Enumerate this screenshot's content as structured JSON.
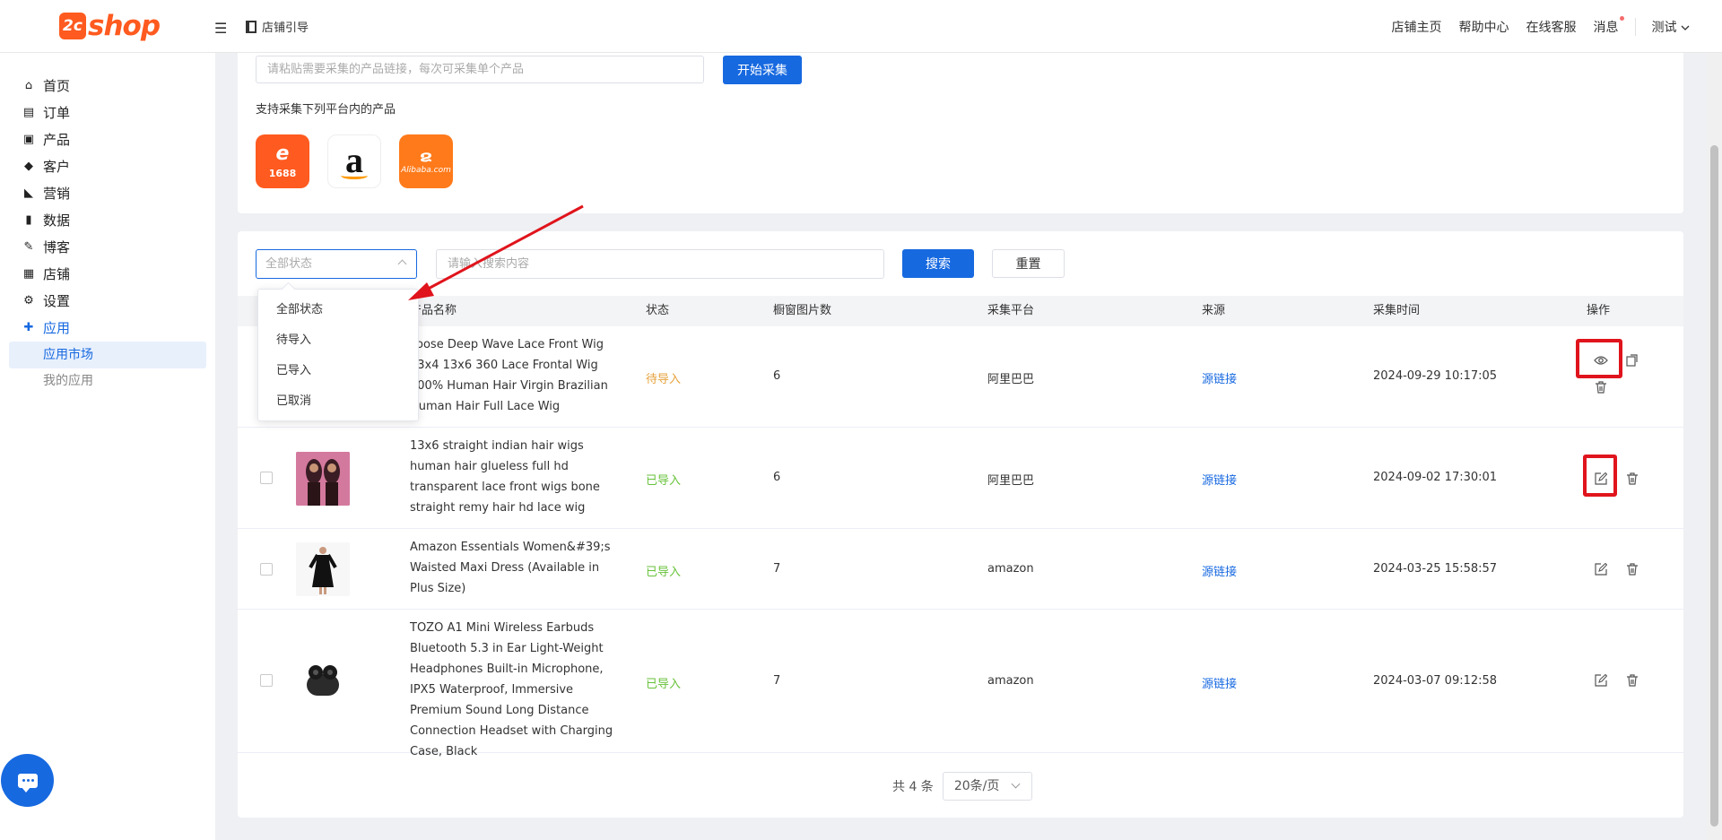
{
  "header": {
    "logo_mark": "2c",
    "logo_text": "shop",
    "store_guide": "店铺引导",
    "links": [
      "店铺主页",
      "帮助中心",
      "在线客服",
      "消息"
    ],
    "user": "测试"
  },
  "sidebar": {
    "items": [
      {
        "label": "首页",
        "icon": "home-icon"
      },
      {
        "label": "订单",
        "icon": "clipboard-icon"
      },
      {
        "label": "产品",
        "icon": "bag-icon"
      },
      {
        "label": "客户",
        "icon": "diamond-icon"
      },
      {
        "label": "营销",
        "icon": "tag-icon"
      },
      {
        "label": "数据",
        "icon": "bar-chart-icon"
      },
      {
        "label": "博客",
        "icon": "edit-icon"
      },
      {
        "label": "店铺",
        "icon": "store-icon"
      },
      {
        "label": "设置",
        "icon": "gear-icon"
      },
      {
        "label": "应用",
        "icon": "puzzle-icon"
      }
    ],
    "sub_items": [
      "应用市场",
      "我的应用"
    ]
  },
  "collect": {
    "url_placeholder": "请粘贴需要采集的产品链接，每次可采集单个产品",
    "start_button": "开始采集",
    "support_text": "支持采集下列平台内的产品",
    "platforms": [
      "1688",
      "a",
      "Alibaba.com"
    ]
  },
  "filter": {
    "status_placeholder": "全部状态",
    "search_placeholder": "请输入搜索内容",
    "search_button": "搜索",
    "reset_button": "重置",
    "dropdown_options": [
      "全部状态",
      "待导入",
      "已导入",
      "已取消"
    ]
  },
  "table": {
    "headers": [
      "产品名称",
      "状态",
      "橱窗图片数",
      "采集平台",
      "来源",
      "采集时间",
      "操作"
    ],
    "rows": [
      {
        "name": "Loose Deep Wave Lace Front Wig 13x4 13x6 360 Lace Frontal Wig 100% Human Hair Virgin Brazilian Human Hair Full Lace Wig",
        "status": "待导入",
        "images": "6",
        "platform": "阿里巴巴",
        "source": "源链接",
        "time": "2024-09-29 10:17:05"
      },
      {
        "name": "13x6 straight indian hair wigs human hair glueless full hd transparent lace front wigs bone straight remy hair hd lace wig",
        "status": "已导入",
        "images": "6",
        "platform": "阿里巴巴",
        "source": "源链接",
        "time": "2024-09-02 17:30:01"
      },
      {
        "name": "Amazon Essentials Women&#39;s Waisted Maxi Dress (Available in Plus Size)",
        "status": "已导入",
        "images": "7",
        "platform": "amazon",
        "source": "源链接",
        "time": "2024-03-25 15:58:57"
      },
      {
        "name": "TOZO A1 Mini Wireless Earbuds Bluetooth 5.3 in Ear Light-Weight Headphones Built-in Microphone, IPX5 Waterproof, Immersive Premium Sound Long Distance Connection Headset with Charging Case, Black",
        "status": "已导入",
        "images": "7",
        "platform": "amazon",
        "source": "源链接",
        "time": "2024-03-07 09:12:58"
      }
    ]
  },
  "pager": {
    "total": "共 4 条",
    "page_size": "20条/页"
  },
  "colors": {
    "primary": "#1769e0",
    "brand": "#ff5a1f",
    "pending": "#e6a23c",
    "imported": "#67c23a",
    "annotation": "#e0141c"
  }
}
